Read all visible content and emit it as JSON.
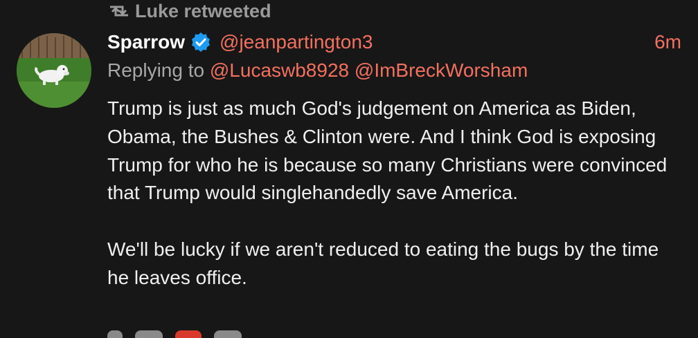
{
  "retweet": {
    "icon": "retweet-icon",
    "label": "Luke retweeted"
  },
  "tweet": {
    "author": {
      "display_name": "Sparrow",
      "verified": true,
      "verified_icon": "verified-badge-icon",
      "handle": "@jeanpartington3",
      "avatar": "dog-on-grass-avatar"
    },
    "time": "6m",
    "replying_to": {
      "prefix": "Replying to",
      "mentions": [
        "@Lucaswb8928",
        "@ImBreckWorsham"
      ]
    },
    "paragraphs": [
      "Trump is just as much God's judgement on America as Biden, Obama, the Bushes & Clinton were.  And I think God is exposing Trump for who he is because so many Christians were convinced that Trump would singlehandedly save America.",
      "We'll be lucky if we aren't reduced to eating the bugs by the time he leaves office."
    ]
  },
  "colors": {
    "background": "#171717",
    "accent": "#f4705f",
    "muted": "#9a9a9a",
    "verified": "#1d9bf0"
  }
}
